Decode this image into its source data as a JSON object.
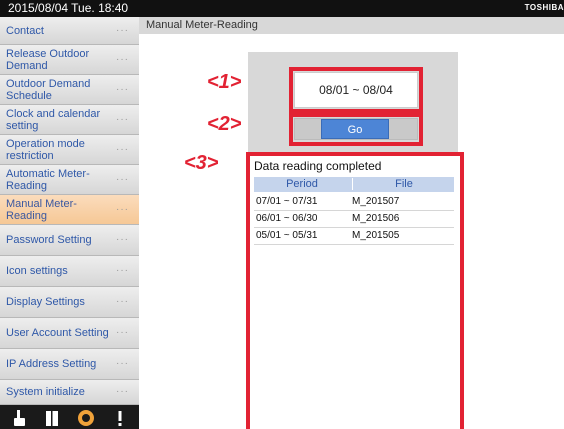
{
  "status_bar": {
    "datetime": "2015/08/04  Tue.  18:40",
    "brand": "TOSHIBA"
  },
  "sidebar": {
    "items": [
      {
        "label": "Contact"
      },
      {
        "label": "Release Outdoor Demand"
      },
      {
        "label": "Outdoor Demand Schedule"
      },
      {
        "label": "Clock and calendar setting"
      },
      {
        "label": "Operation mode restriction"
      },
      {
        "label": "Automatic Meter-Reading"
      },
      {
        "label": "Manual Meter-Reading"
      },
      {
        "label": "Password Setting"
      },
      {
        "label": "Icon settings"
      },
      {
        "label": "Display Settings"
      },
      {
        "label": "User Account Setting"
      },
      {
        "label": "IP Address Setting"
      },
      {
        "label": "System initialize"
      }
    ],
    "dots": "···",
    "active_index": 6
  },
  "page": {
    "title": "Manual Meter-Reading"
  },
  "reading": {
    "range": "08/01 ~ 08/04",
    "go_label": "Go"
  },
  "callouts": {
    "one": "<1>",
    "two": "<2>",
    "three": "<3>"
  },
  "results": {
    "status": "Data reading completed",
    "columns": [
      "Period",
      "File"
    ],
    "rows": [
      {
        "period": "07/01 ~ 07/31",
        "file": "M_201507"
      },
      {
        "period": "06/01 ~ 06/30",
        "file": "M_201506"
      },
      {
        "period": "05/01 ~ 05/31",
        "file": "M_201505"
      }
    ]
  },
  "colors": {
    "callout": "#e22233",
    "accent": "#4d85d6",
    "active_item": "#f6c896"
  }
}
